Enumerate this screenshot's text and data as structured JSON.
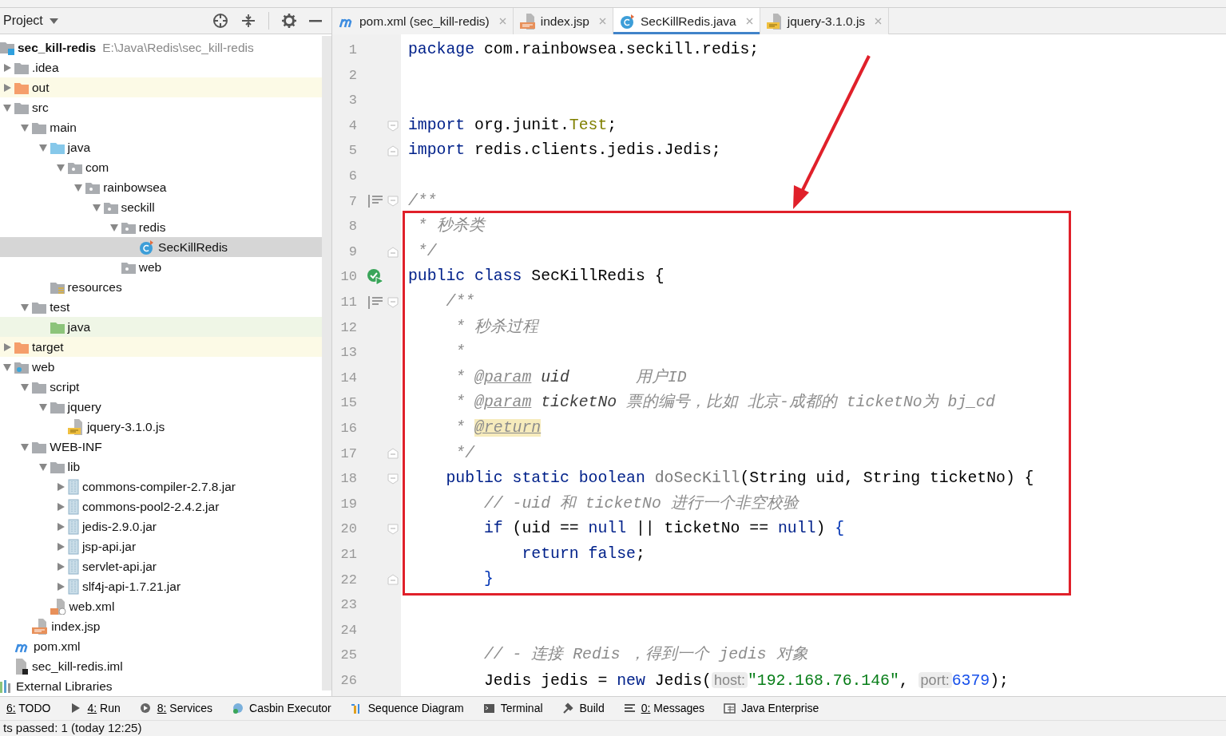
{
  "project_panel": {
    "title": "Project",
    "tree": [
      {
        "label": "sec_kill-redis",
        "path": "E:\\Java\\Redis\\sec_kill-redis",
        "kind": "module",
        "selected": false,
        "children": [
          {
            "label": ".idea",
            "kind": "folder",
            "expanded": false,
            "selected": false
          },
          {
            "label": "out",
            "kind": "excluded",
            "expanded": false,
            "selected": false
          },
          {
            "label": "src",
            "kind": "folder",
            "expanded": true,
            "selected": false,
            "children": [
              {
                "label": "main",
                "kind": "folder",
                "expanded": true,
                "selected": false,
                "children": [
                  {
                    "label": "java",
                    "kind": "source",
                    "expanded": true,
                    "selected": false,
                    "children": [
                      {
                        "label": "com",
                        "kind": "package",
                        "expanded": true,
                        "selected": false,
                        "children": [
                          {
                            "label": "rainbowsea",
                            "kind": "package",
                            "expanded": true,
                            "selected": false,
                            "children": [
                              {
                                "label": "seckill",
                                "kind": "package",
                                "expanded": true,
                                "selected": false,
                                "children": [
                                  {
                                    "label": "redis",
                                    "kind": "package",
                                    "expanded": true,
                                    "selected": false,
                                    "children": [
                                      {
                                        "label": "SecKillRedis",
                                        "kind": "class",
                                        "selected": true
                                      }
                                    ]
                                  },
                                  {
                                    "label": "web",
                                    "kind": "package",
                                    "selected": false
                                  }
                                ]
                              }
                            ]
                          }
                        ]
                      }
                    ]
                  },
                  {
                    "label": "resources",
                    "kind": "resources",
                    "selected": false
                  }
                ]
              },
              {
                "label": "test",
                "kind": "folder",
                "expanded": true,
                "selected": false,
                "children": [
                  {
                    "label": "java",
                    "kind": "test-source",
                    "selected": false
                  }
                ]
              }
            ]
          },
          {
            "label": "target",
            "kind": "excluded",
            "expanded": false,
            "selected": false
          },
          {
            "label": "web",
            "kind": "web",
            "expanded": true,
            "selected": false,
            "children": [
              {
                "label": "script",
                "kind": "folder",
                "expanded": true,
                "selected": false,
                "children": [
                  {
                    "label": "jquery",
                    "kind": "folder",
                    "expanded": true,
                    "selected": false,
                    "children": [
                      {
                        "label": "jquery-3.1.0.js",
                        "kind": "js",
                        "selected": false
                      }
                    ]
                  }
                ]
              },
              {
                "label": "WEB-INF",
                "kind": "folder",
                "expanded": true,
                "selected": false,
                "children": [
                  {
                    "label": "lib",
                    "kind": "folder",
                    "expanded": true,
                    "selected": false,
                    "children": [
                      {
                        "label": "commons-compiler-2.7.8.jar",
                        "kind": "jar",
                        "expanded": false,
                        "selected": false
                      },
                      {
                        "label": "commons-pool2-2.4.2.jar",
                        "kind": "jar",
                        "expanded": false,
                        "selected": false
                      },
                      {
                        "label": "jedis-2.9.0.jar",
                        "kind": "jar",
                        "expanded": false,
                        "selected": false
                      },
                      {
                        "label": "jsp-api.jar",
                        "kind": "jar",
                        "expanded": false,
                        "selected": false
                      },
                      {
                        "label": "servlet-api.jar",
                        "kind": "jar",
                        "expanded": false,
                        "selected": false
                      },
                      {
                        "label": "slf4j-api-1.7.21.jar",
                        "kind": "jar",
                        "expanded": false,
                        "selected": false
                      }
                    ]
                  },
                  {
                    "label": "web.xml",
                    "kind": "xml",
                    "selected": false
                  }
                ]
              },
              {
                "label": "index.jsp",
                "kind": "jsp",
                "selected": false
              }
            ]
          },
          {
            "label": "pom.xml",
            "kind": "maven",
            "selected": false
          },
          {
            "label": "sec_kill-redis.iml",
            "kind": "iml",
            "selected": false
          }
        ]
      },
      {
        "label": "External Libraries",
        "kind": "libraries",
        "selected": false
      }
    ]
  },
  "editor": {
    "tabs": [
      {
        "label": "pom.xml (sec_kill-redis)",
        "kind": "maven",
        "selected": false
      },
      {
        "label": "index.jsp",
        "kind": "jsp",
        "selected": false
      },
      {
        "label": "SecKillRedis.java",
        "kind": "class",
        "selected": true
      },
      {
        "label": "jquery-3.1.0.js",
        "kind": "js",
        "selected": false
      }
    ],
    "lines": [
      {
        "number": "1",
        "tokens": [
          {
            "kind": "keyword",
            "text": "package"
          },
          {
            "kind": "plain",
            "text": " com.rainbowsea.seckill.redis;"
          }
        ]
      },
      {
        "number": "2"
      },
      {
        "number": "3"
      },
      {
        "number": "4",
        "fold_start": true,
        "tokens": [
          {
            "kind": "keyword",
            "text": "import"
          },
          {
            "kind": "plain",
            "text": " org.junit."
          },
          {
            "kind": "annotation",
            "text": "Test"
          },
          {
            "kind": "plain",
            "text": ";"
          }
        ]
      },
      {
        "number": "5",
        "fold_end": true,
        "tokens": [
          {
            "kind": "keyword",
            "text": "import"
          },
          {
            "kind": "plain",
            "text": " redis.clients.jedis.Jedis;"
          }
        ]
      },
      {
        "number": "6"
      },
      {
        "number": "7",
        "doc_icon": true,
        "fold_start": true,
        "tokens": [
          {
            "kind": "comment",
            "text": "/**"
          }
        ]
      },
      {
        "number": "8",
        "tokens": [
          {
            "kind": "comment",
            "text": " * 秒杀类"
          }
        ]
      },
      {
        "number": "9",
        "fold_end": true,
        "tokens": [
          {
            "kind": "comment",
            "text": " */"
          }
        ]
      },
      {
        "number": "10",
        "run_icon": true,
        "tokens": [
          {
            "kind": "keyword",
            "text": "public class"
          },
          {
            "kind": "plain",
            "text": " SecKillRedis {"
          }
        ]
      },
      {
        "number": "11",
        "doc_icon": true,
        "fold_start": true,
        "tokens": [
          {
            "kind": "comment",
            "text": "    /**"
          }
        ]
      },
      {
        "number": "12",
        "tokens": [
          {
            "kind": "comment",
            "text": "     * 秒杀过程"
          }
        ]
      },
      {
        "number": "13",
        "tokens": [
          {
            "kind": "comment",
            "text": "     *"
          }
        ]
      },
      {
        "number": "14",
        "tokens": [
          {
            "kind": "comment",
            "text": "     * "
          },
          {
            "kind": "doctag",
            "text": "@param"
          },
          {
            "kind": "docparam",
            "text": " uid"
          },
          {
            "kind": "comment",
            "text": "       用户ID"
          }
        ]
      },
      {
        "number": "15",
        "tokens": [
          {
            "kind": "comment",
            "text": "     * "
          },
          {
            "kind": "doctag",
            "text": "@param"
          },
          {
            "kind": "docparam",
            "text": " ticketNo"
          },
          {
            "kind": "comment",
            "text": " 票的编号，比如 北京-成都的 ticketNo为 bj_cd"
          }
        ]
      },
      {
        "number": "16",
        "tokens": [
          {
            "kind": "comment",
            "text": "     * "
          },
          {
            "kind": "doctag-highlight",
            "text": "@return"
          }
        ]
      },
      {
        "number": "17",
        "fold_end": true,
        "tokens": [
          {
            "kind": "comment",
            "text": "     */"
          }
        ]
      },
      {
        "number": "18",
        "fold_start": true,
        "tokens": [
          {
            "kind": "keyword",
            "text": "    public static boolean"
          },
          {
            "kind": "unused",
            "text": " doSecKill"
          },
          {
            "kind": "plain",
            "text": "(String uid, String ticketNo) {"
          }
        ]
      },
      {
        "number": "19",
        "tokens": [
          {
            "kind": "comment",
            "text": "        // -uid 和 ticketNo 进行一个非空校验"
          }
        ]
      },
      {
        "number": "20",
        "fold_start": true,
        "tokens": [
          {
            "kind": "keyword",
            "text": "        if"
          },
          {
            "kind": "plain",
            "text": " (uid == "
          },
          {
            "kind": "keyword",
            "text": "null"
          },
          {
            "kind": "plain",
            "text": " || ticketNo == "
          },
          {
            "kind": "keyword",
            "text": "null"
          },
          {
            "kind": "plain",
            "text": ") "
          },
          {
            "kind": "brace",
            "text": "{"
          }
        ]
      },
      {
        "number": "21",
        "tokens": [
          {
            "kind": "keyword",
            "text": "            return false"
          },
          {
            "kind": "plain",
            "text": ";"
          }
        ]
      },
      {
        "number": "22",
        "fold_end": true,
        "tokens": [
          {
            "kind": "brace",
            "text": "        }"
          }
        ]
      },
      {
        "number": "23"
      },
      {
        "number": "24"
      },
      {
        "number": "25",
        "tokens": [
          {
            "kind": "comment",
            "text": "        // - 连接 Redis ，得到一个 jedis 对象"
          }
        ]
      },
      {
        "number": "26",
        "tokens": [
          {
            "kind": "plain",
            "text": "        Jedis jedis = "
          },
          {
            "kind": "keyword",
            "text": "new"
          },
          {
            "kind": "plain",
            "text": " Jedis("
          },
          {
            "kind": "hint",
            "text": "host:"
          },
          {
            "kind": "string",
            "text": "\"192.168.76.146\""
          },
          {
            "kind": "plain",
            "text": ", "
          },
          {
            "kind": "hint",
            "text": "port:"
          },
          {
            "kind": "number",
            "text": "6379"
          },
          {
            "kind": "plain",
            "text": ");"
          }
        ]
      }
    ]
  },
  "tool_windows": [
    {
      "label": "6: TODO",
      "kind": "todo",
      "mnemonic": true
    },
    {
      "label": "4: Run",
      "kind": "run",
      "mnemonic": true
    },
    {
      "label": "8: Services",
      "kind": "services",
      "mnemonic": true
    },
    {
      "label": "Casbin Executor",
      "kind": "casbin",
      "mnemonic": false
    },
    {
      "label": "Sequence Diagram",
      "kind": "sequence",
      "mnemonic": false
    },
    {
      "label": "Terminal",
      "kind": "terminal",
      "mnemonic": false
    },
    {
      "label": "Build",
      "kind": "build",
      "mnemonic": false
    },
    {
      "label": "0: Messages",
      "kind": "messages",
      "mnemonic": true
    },
    {
      "label": "Java Enterprise",
      "kind": "enterprise",
      "mnemonic": false
    }
  ],
  "status_bar": {
    "text": "ts passed: 1 (today 12:25)"
  }
}
